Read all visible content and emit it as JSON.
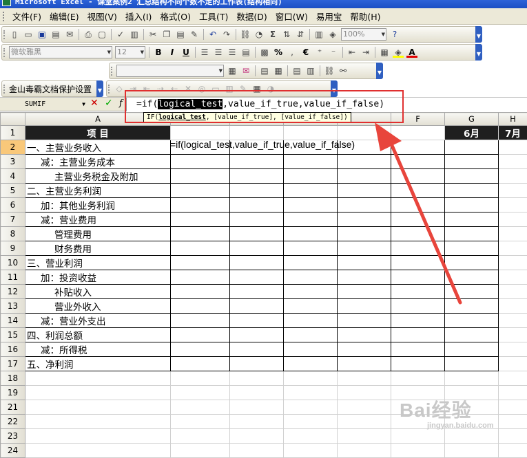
{
  "window": {
    "title": "Microsoft Excel - 课堂案例2 汇总结构不同个数不定的工作表(结构相同)"
  },
  "menu": [
    "文件(F)",
    "编辑(E)",
    "视图(V)",
    "插入(I)",
    "格式(O)",
    "工具(T)",
    "数据(D)",
    "窗口(W)",
    "易用宝",
    "帮助(H)"
  ],
  "toolbar": {
    "zoom": "100%",
    "font_name": "微软雅黑",
    "font_size": "12",
    "bold": "B",
    "italic": "I",
    "underline": "U",
    "currency": "€",
    "percent": "%",
    "wps_protect": "金山毒霸文档保护设置"
  },
  "formula_bar": {
    "name_box": "SUMIF",
    "cancel": "✕",
    "enter": "✓",
    "fx": "f",
    "pre": "=if(",
    "selected": "logical_test",
    "post": ",value_if_true,value_if_false)"
  },
  "tooltip": {
    "pre": "IF(",
    "bold": "logical_test",
    "post": ", [value_if_true], [value_if_false])"
  },
  "columns": [
    "A",
    "",
    "",
    "",
    "",
    "F",
    "G",
    "H"
  ],
  "sheet": {
    "header_cell": "项    目",
    "month6": "6月",
    "month7": "7月",
    "editing_text": "=if(logical_test,value_if_true,value_if_false)",
    "row_numbers": [
      "1",
      "2",
      "3",
      "4",
      "5",
      "6",
      "7",
      "8",
      "9",
      "10",
      "11",
      "12",
      "13",
      "14",
      "15",
      "16",
      "17",
      "18",
      "19",
      "21",
      "22",
      "23",
      "24"
    ],
    "items": [
      {
        "text": "一、主营业务收入",
        "indent": 0
      },
      {
        "text": "减：主营业务成本",
        "indent": 1
      },
      {
        "text": "主营业务税金及附加",
        "indent": 2
      },
      {
        "text": "二、主营业务利润",
        "indent": 0
      },
      {
        "text": "加：其他业务利润",
        "indent": 1
      },
      {
        "text": "减：营业费用",
        "indent": 1
      },
      {
        "text": "管理费用",
        "indent": 2
      },
      {
        "text": "财务费用",
        "indent": 2
      },
      {
        "text": "三、营业利润",
        "indent": 0
      },
      {
        "text": "加：投资收益",
        "indent": 1
      },
      {
        "text": "补贴收入",
        "indent": 2
      },
      {
        "text": "营业外收入",
        "indent": 2
      },
      {
        "text": "减：营业外支出",
        "indent": 1
      },
      {
        "text": "四、利润总额",
        "indent": 0
      },
      {
        "text": "减：所得税",
        "indent": 1
      },
      {
        "text": "五、净利润",
        "indent": 0
      }
    ]
  },
  "watermark": {
    "brand": "Bai经验",
    "site": "jingyan.baidu.com"
  }
}
